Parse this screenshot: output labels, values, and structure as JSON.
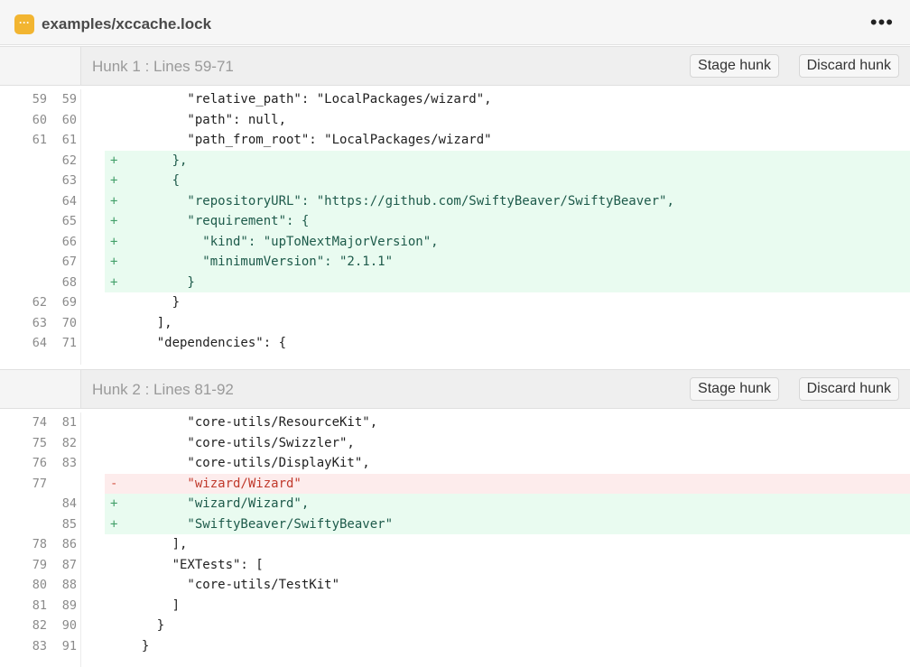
{
  "header": {
    "file_icon_glyph": "···",
    "file_name": "examples/xccache.lock",
    "more_glyph": "•••"
  },
  "hunks": [
    {
      "title": "Hunk 1 : Lines 59-71",
      "stage_label": "Stage hunk",
      "discard_label": "Discard hunk",
      "lines": [
        {
          "type": "context",
          "old": "59",
          "new": "59",
          "sign": "",
          "text": "        \"relative_path\": \"LocalPackages/wizard\","
        },
        {
          "type": "context",
          "old": "60",
          "new": "60",
          "sign": "",
          "text": "        \"path\": null,"
        },
        {
          "type": "context",
          "old": "61",
          "new": "61",
          "sign": "",
          "text": "        \"path_from_root\": \"LocalPackages/wizard\""
        },
        {
          "type": "add",
          "old": "",
          "new": "62",
          "sign": "+",
          "text": "      },"
        },
        {
          "type": "add",
          "old": "",
          "new": "63",
          "sign": "+",
          "text": "      {"
        },
        {
          "type": "add",
          "old": "",
          "new": "64",
          "sign": "+",
          "text": "        \"repositoryURL\": \"https://github.com/SwiftyBeaver/SwiftyBeaver\","
        },
        {
          "type": "add",
          "old": "",
          "new": "65",
          "sign": "+",
          "text": "        \"requirement\": {"
        },
        {
          "type": "add",
          "old": "",
          "new": "66",
          "sign": "+",
          "text": "          \"kind\": \"upToNextMajorVersion\","
        },
        {
          "type": "add",
          "old": "",
          "new": "67",
          "sign": "+",
          "text": "          \"minimumVersion\": \"2.1.1\""
        },
        {
          "type": "add",
          "old": "",
          "new": "68",
          "sign": "+",
          "text": "        }"
        },
        {
          "type": "context",
          "old": "62",
          "new": "69",
          "sign": "",
          "text": "      }"
        },
        {
          "type": "context",
          "old": "63",
          "new": "70",
          "sign": "",
          "text": "    ],"
        },
        {
          "type": "context",
          "old": "64",
          "new": "71",
          "sign": "",
          "text": "    \"dependencies\": {"
        }
      ]
    },
    {
      "title": "Hunk 2 : Lines 81-92",
      "stage_label": "Stage hunk",
      "discard_label": "Discard hunk",
      "lines": [
        {
          "type": "context",
          "old": "74",
          "new": "81",
          "sign": "",
          "text": "        \"core-utils/ResourceKit\","
        },
        {
          "type": "context",
          "old": "75",
          "new": "82",
          "sign": "",
          "text": "        \"core-utils/Swizzler\","
        },
        {
          "type": "context",
          "old": "76",
          "new": "83",
          "sign": "",
          "text": "        \"core-utils/DisplayKit\","
        },
        {
          "type": "del",
          "old": "77",
          "new": "",
          "sign": "-",
          "text": "        \"wizard/Wizard\""
        },
        {
          "type": "add",
          "old": "",
          "new": "84",
          "sign": "+",
          "text": "        \"wizard/Wizard\","
        },
        {
          "type": "add",
          "old": "",
          "new": "85",
          "sign": "+",
          "text": "        \"SwiftyBeaver/SwiftyBeaver\""
        },
        {
          "type": "context",
          "old": "78",
          "new": "86",
          "sign": "",
          "text": "      ],"
        },
        {
          "type": "context",
          "old": "79",
          "new": "87",
          "sign": "",
          "text": "      \"EXTests\": ["
        },
        {
          "type": "context",
          "old": "80",
          "new": "88",
          "sign": "",
          "text": "        \"core-utils/TestKit\""
        },
        {
          "type": "context",
          "old": "81",
          "new": "89",
          "sign": "",
          "text": "      ]"
        },
        {
          "type": "context",
          "old": "82",
          "new": "90",
          "sign": "",
          "text": "    }"
        },
        {
          "type": "context",
          "old": "83",
          "new": "91",
          "sign": "",
          "text": "  }"
        }
      ]
    }
  ],
  "colors": {
    "added_bg": "#e9fbf0",
    "removed_bg": "#fdecec",
    "file_icon": "#f2b531"
  }
}
